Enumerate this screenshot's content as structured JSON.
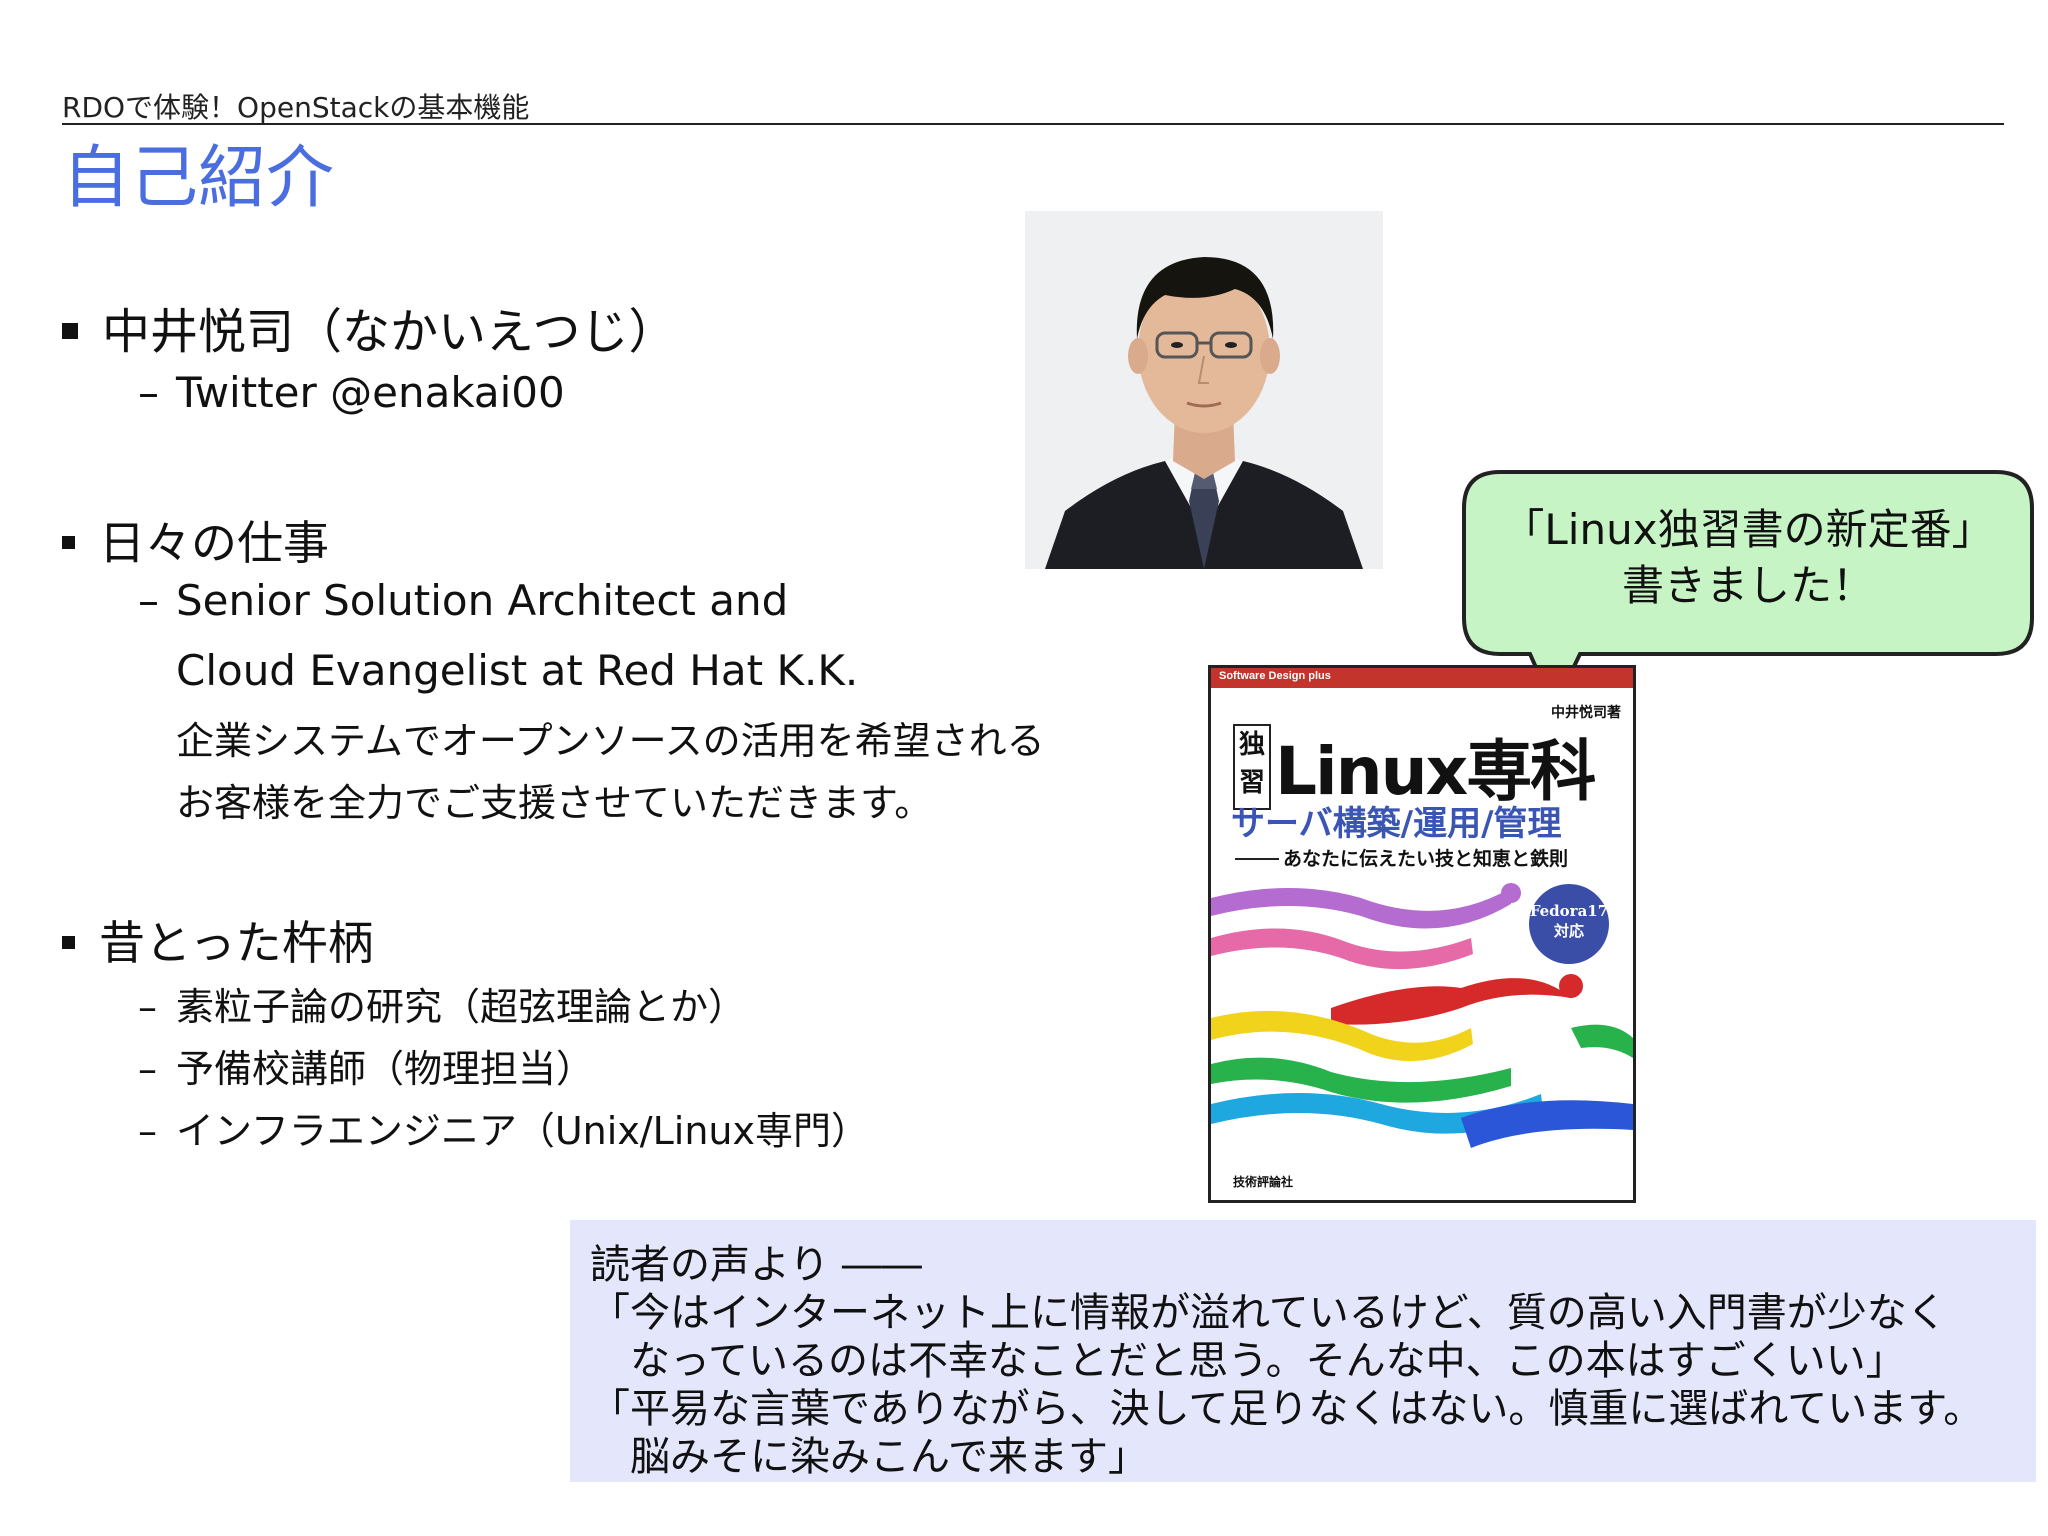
{
  "header": {
    "text": "RDOで体験！OpenStackの基本機能"
  },
  "title": "自己紹介",
  "bullets": [
    {
      "label": "中井悦司（なかいえつじ）",
      "subs": [
        "Twitter @enakai00"
      ]
    },
    {
      "label": "日々の仕事",
      "subs": [
        "Senior Solution Architect and",
        "Cloud Evangelist at Red Hat K.K.",
        "企業システムでオープンソースの活用を希望される",
        "お客様を全力でご支援させていただきます。"
      ]
    },
    {
      "label": "昔とった杵柄",
      "subs": [
        "素粒子論の研究（超弦理論とか）",
        "予備校講師（物理担当）",
        "インフラエンジニア（Unix/Linux専門）"
      ]
    }
  ],
  "callout": {
    "line1": "「Linux独習書の新定番」",
    "line2": "書きました！"
  },
  "book": {
    "series": "Software Design plus",
    "author": "中井悦司著",
    "badge_top": "独",
    "badge_bottom": "習",
    "title_main": "Linux専科",
    "subtitle": "サーバ構築/運用/管理",
    "tagline": "あなたに伝えたい技と知恵と鉄則",
    "fedora_line1": "Fedora17",
    "fedora_line2": "対応",
    "publisher": "技術評論社"
  },
  "quote": {
    "heading": "読者の声より ――",
    "lines": [
      "「今はインターネット上に情報が溢れているけど、質の高い入門書が少なく",
      "なっているのは不幸なことだと思う。そんな中、この本はすごくいい」",
      "「平易な言葉でありながら、決して足りなくはない。慎重に選ばれています。",
      "脳みそに染みこんで来ます」"
    ]
  }
}
